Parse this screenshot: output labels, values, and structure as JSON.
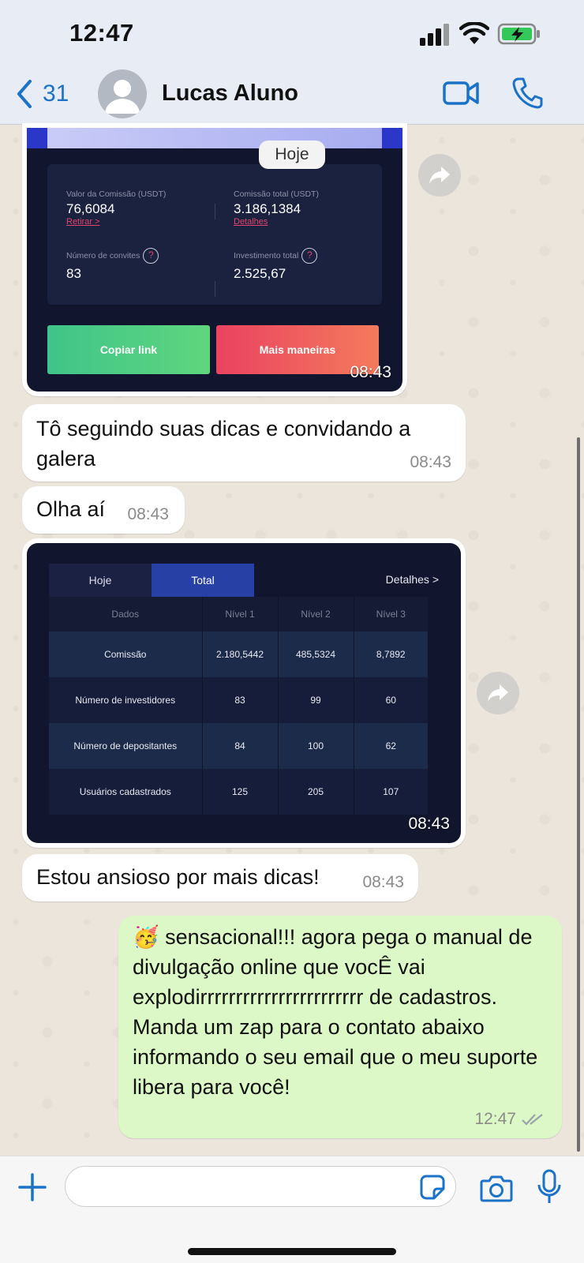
{
  "status_bar": {
    "time": "12:47"
  },
  "header": {
    "back_count": "31",
    "contact_name": "Lucas Aluno"
  },
  "chat": {
    "date_pill": "Hoje",
    "msg1_image": {
      "commission_label": "Valor da Comissão  (USDT)",
      "commission_value": "76,6084",
      "withdraw_link": "Retirar >",
      "total_commission_label": "Comissão total  (USDT)",
      "total_commission_value": "3.186,1384",
      "details_link": "Detalhes",
      "invites_label": "Número de convites",
      "invites_value": "83",
      "investment_label": "Investimento total",
      "investment_value": "2.525,67",
      "copy_button": "Copiar link",
      "more_button": "Mais maneiras",
      "time": "08:43"
    },
    "msg2": {
      "text": "Tô seguindo suas dicas e convidando a galera",
      "time": "08:43"
    },
    "msg3": {
      "text": "Olha aí",
      "time": "08:43"
    },
    "msg4_image": {
      "tab_today": "Hoje",
      "tab_total": "Total",
      "details": "Detalhes >",
      "columns": [
        "Dados",
        "Nível 1",
        "Nível 2",
        "Nível 3"
      ],
      "rows": [
        [
          "Comissão",
          "2.180,5442",
          "485,5324",
          "8,7892"
        ],
        [
          "Número de investidores",
          "83",
          "99",
          "60"
        ],
        [
          "Número de depositantes",
          "84",
          "100",
          "62"
        ],
        [
          "Usuários cadastrados",
          "125",
          "205",
          "107"
        ]
      ],
      "time": "08:43"
    },
    "msg5": {
      "text": "Estou ansioso por mais dicas!",
      "time": "08:43"
    },
    "msg6": {
      "emoji": "🥳",
      "text": "sensacional!!! agora pega o manual de divulgação online que vocÊ vai explodirrrrrrrrrrrrrrrrrrrrrrr de cadastros. Manda um zap para o contato abaixo informando o seu email que o meu suporte libera para você!",
      "time": "12:47"
    }
  },
  "colors": {
    "accent": "#1a73c8",
    "outgoing_bubble": "#dcf8c6",
    "incoming_bubble": "#ffffff"
  }
}
